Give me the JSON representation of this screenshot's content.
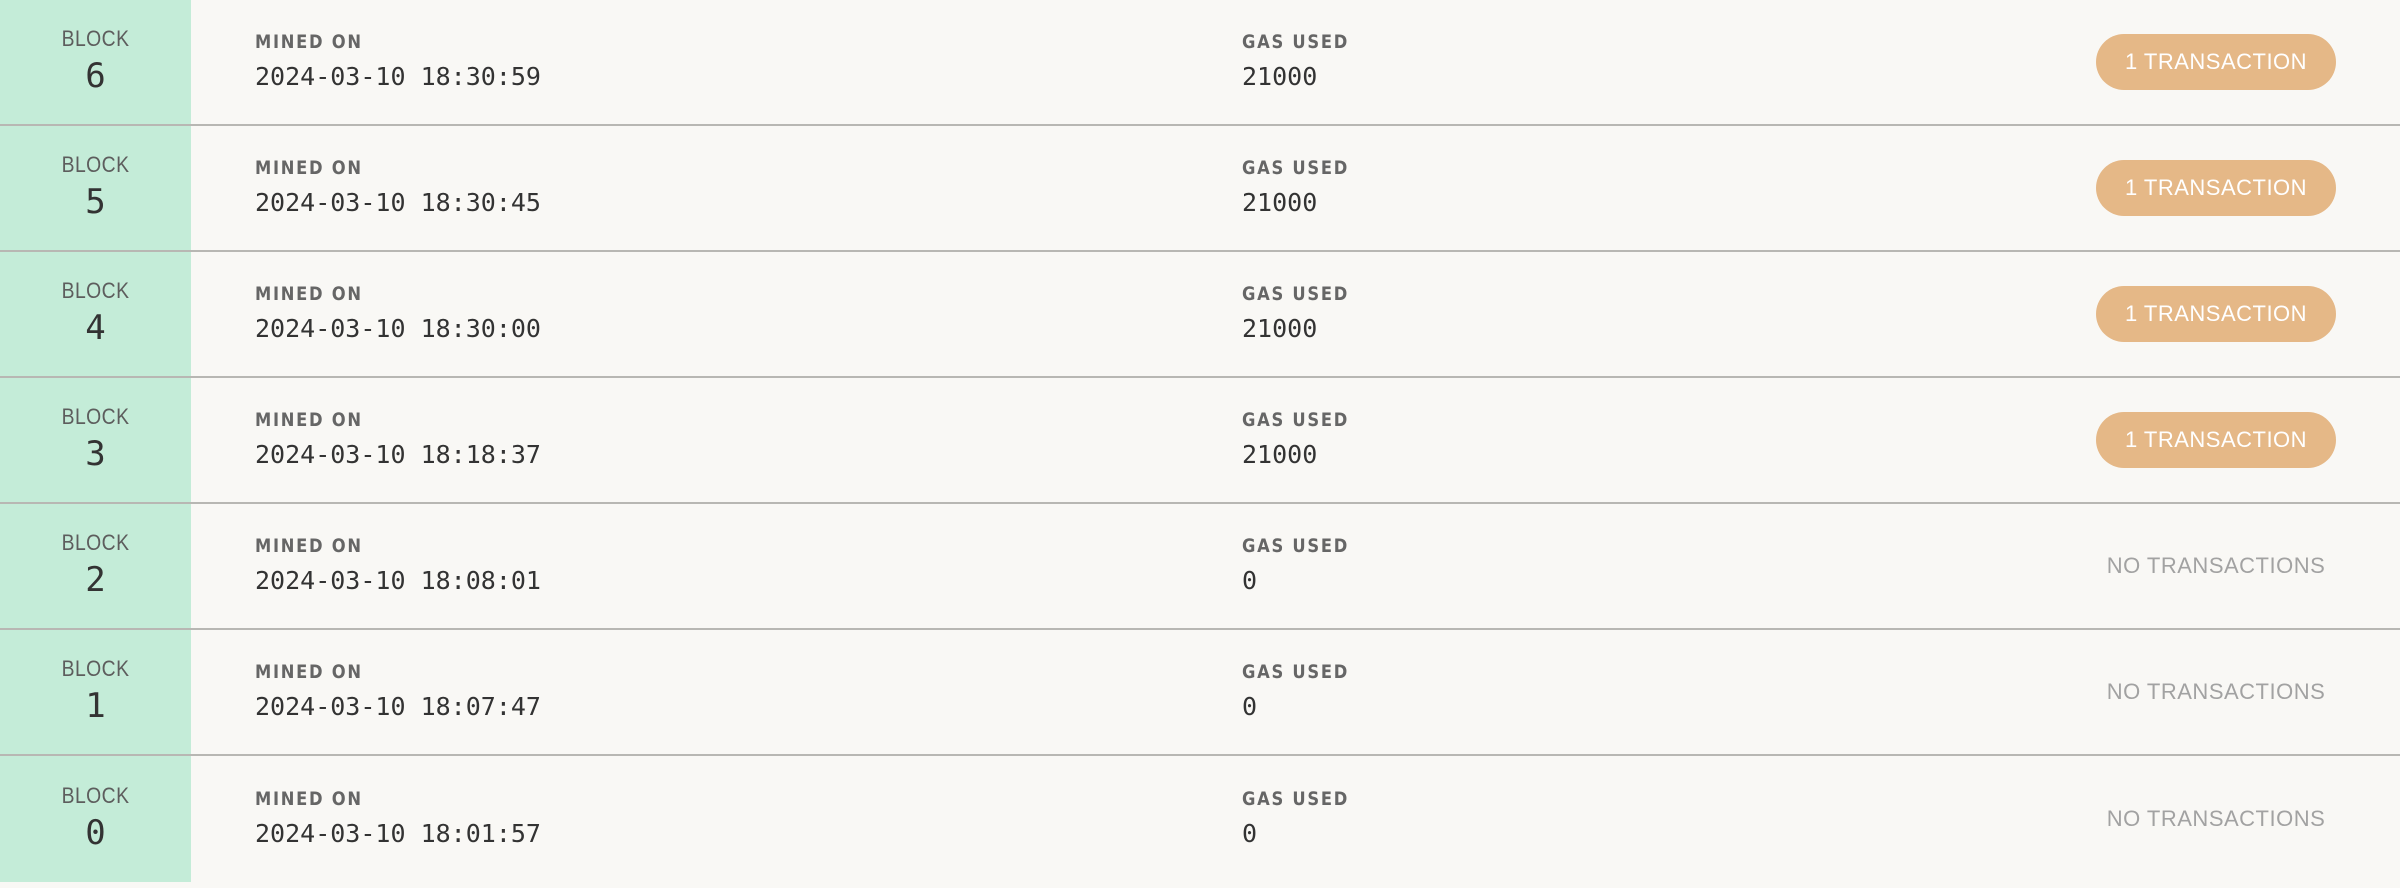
{
  "labels": {
    "block": "BLOCK",
    "mined_on": "MINED ON",
    "gas_used": "GAS USED"
  },
  "colors": {
    "block_column_bg": "#c4ecd8",
    "tx_button_bg": "#e5b887",
    "row_bg": "#f9f8f5",
    "divider": "#b8b7b3",
    "no_tx_text": "#a2a2a2"
  },
  "blocks": [
    {
      "number": "6",
      "mined_on": "2024-03-10 18:30:59",
      "gas_used": "21000",
      "tx_label": "1 TRANSACTION",
      "has_tx": true
    },
    {
      "number": "5",
      "mined_on": "2024-03-10 18:30:45",
      "gas_used": "21000",
      "tx_label": "1 TRANSACTION",
      "has_tx": true
    },
    {
      "number": "4",
      "mined_on": "2024-03-10 18:30:00",
      "gas_used": "21000",
      "tx_label": "1 TRANSACTION",
      "has_tx": true
    },
    {
      "number": "3",
      "mined_on": "2024-03-10 18:18:37",
      "gas_used": "21000",
      "tx_label": "1 TRANSACTION",
      "has_tx": true
    },
    {
      "number": "2",
      "mined_on": "2024-03-10 18:08:01",
      "gas_used": "0",
      "tx_label": "NO TRANSACTIONS",
      "has_tx": false
    },
    {
      "number": "1",
      "mined_on": "2024-03-10 18:07:47",
      "gas_used": "0",
      "tx_label": "NO TRANSACTIONS",
      "has_tx": false
    },
    {
      "number": "0",
      "mined_on": "2024-03-10 18:01:57",
      "gas_used": "0",
      "tx_label": "NO TRANSACTIONS",
      "has_tx": false
    }
  ]
}
